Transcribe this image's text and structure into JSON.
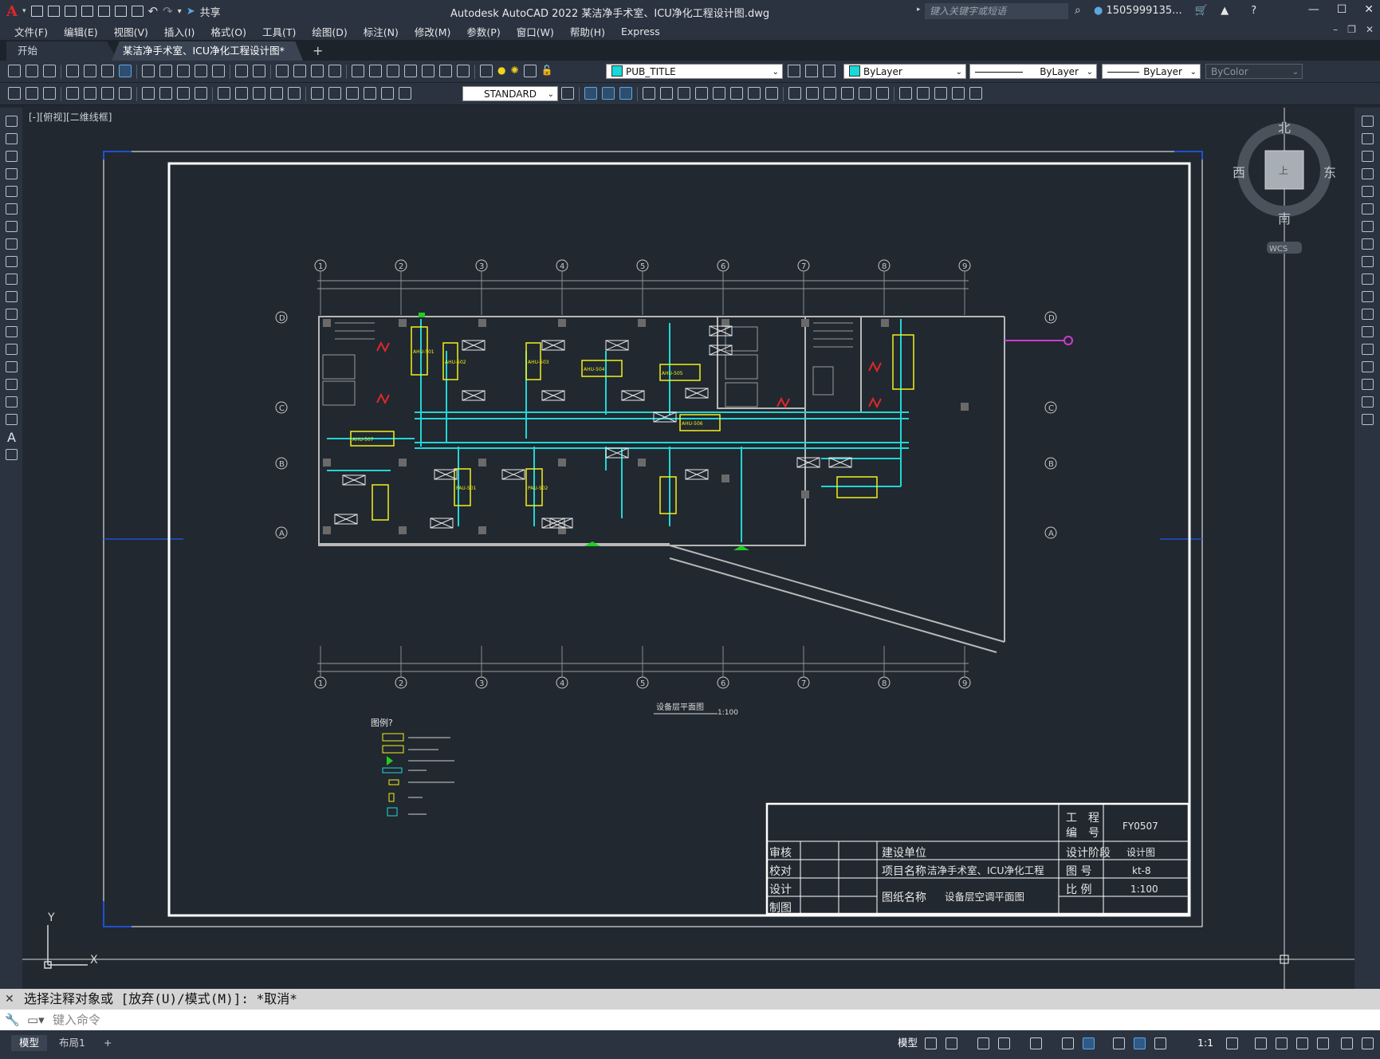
{
  "titlebar": {
    "app_title": "Autodesk AutoCAD 2022    某洁净手术室、ICU净化工程设计图.dwg",
    "share_label": "共享",
    "search_placeholder": "键入关键字或短语",
    "user": "1505999135...",
    "window_controls": [
      "—",
      "☐",
      "✕"
    ]
  },
  "menubar": {
    "items": [
      "文件(F)",
      "编辑(E)",
      "视图(V)",
      "插入(I)",
      "格式(O)",
      "工具(T)",
      "绘图(D)",
      "标注(N)",
      "修改(M)",
      "参数(P)",
      "窗口(W)",
      "帮助(H)",
      "Express"
    ]
  },
  "tabs": {
    "start": "开始",
    "drawing": "某洁净手术室、ICU净化工程设计图*",
    "close": "✕",
    "add": "+"
  },
  "toolbar": {
    "layer": "PUB_TITLE",
    "color": "ByLayer",
    "linetype": "ByLayer",
    "lineweight": "ByLayer",
    "plotstyle": "ByColor",
    "textstyle": "STANDARD",
    "layer_swatch": "#18d8d8",
    "color_swatch": "#18d8d8"
  },
  "viewport": {
    "label": "[-][俯视][二维线框]",
    "compass": {
      "north": "北",
      "south": "南",
      "east": "东",
      "west": "西",
      "top": "上",
      "wcs": "WCS"
    },
    "ucs": {
      "x": "X",
      "y": "Y"
    }
  },
  "drawing": {
    "grid_numbers": [
      "1",
      "2",
      "3",
      "4",
      "5",
      "6",
      "7",
      "8",
      "9"
    ],
    "grid_letters": [
      "D",
      "C",
      "B",
      "A"
    ],
    "plan_title": "设备层平面图",
    "plan_scale": "1:100",
    "legend_title": "图例?",
    "units": [
      "AHU-501",
      "AHU-502",
      "AHU-503",
      "AHU-504",
      "AHU-505",
      "AHU-506",
      "AHU-507",
      "PAU-501",
      "PAU-502"
    ],
    "colors": {
      "duct": "#22d6d6",
      "unit": "#f2ef1a",
      "wall": "#b8b8b8",
      "red": "#e0262c",
      "green": "#22cc22",
      "magenta": "#d03ad0",
      "frame": "#ffffff"
    }
  },
  "titleblock": {
    "row_labels": [
      "审核",
      "校对",
      "设计",
      "制图"
    ],
    "construction_unit_label": "建设单位",
    "project_name_label": "项目名称",
    "project_name": "洁净手术室、ICU净化工程",
    "drawing_name_label": "图纸名称",
    "drawing_name": "设备层空调平面图",
    "project_no_label": "工 程\n编 号",
    "project_no": "FY0507",
    "stage_label": "设计阶段",
    "stage": "设计图",
    "drawing_no_label": "图 号",
    "drawing_no": "kt-8",
    "scale_label": "比 例",
    "scale": "1:100"
  },
  "command": {
    "history": "选择注释对象或 [放弃(U)/模式(M)]: *取消*",
    "input_placeholder": "键入命令"
  },
  "statusbar": {
    "model_tab": "模型",
    "layout_tab": "布局1",
    "add_tab": "+",
    "model_label": "模型",
    "scale": "1:1"
  }
}
